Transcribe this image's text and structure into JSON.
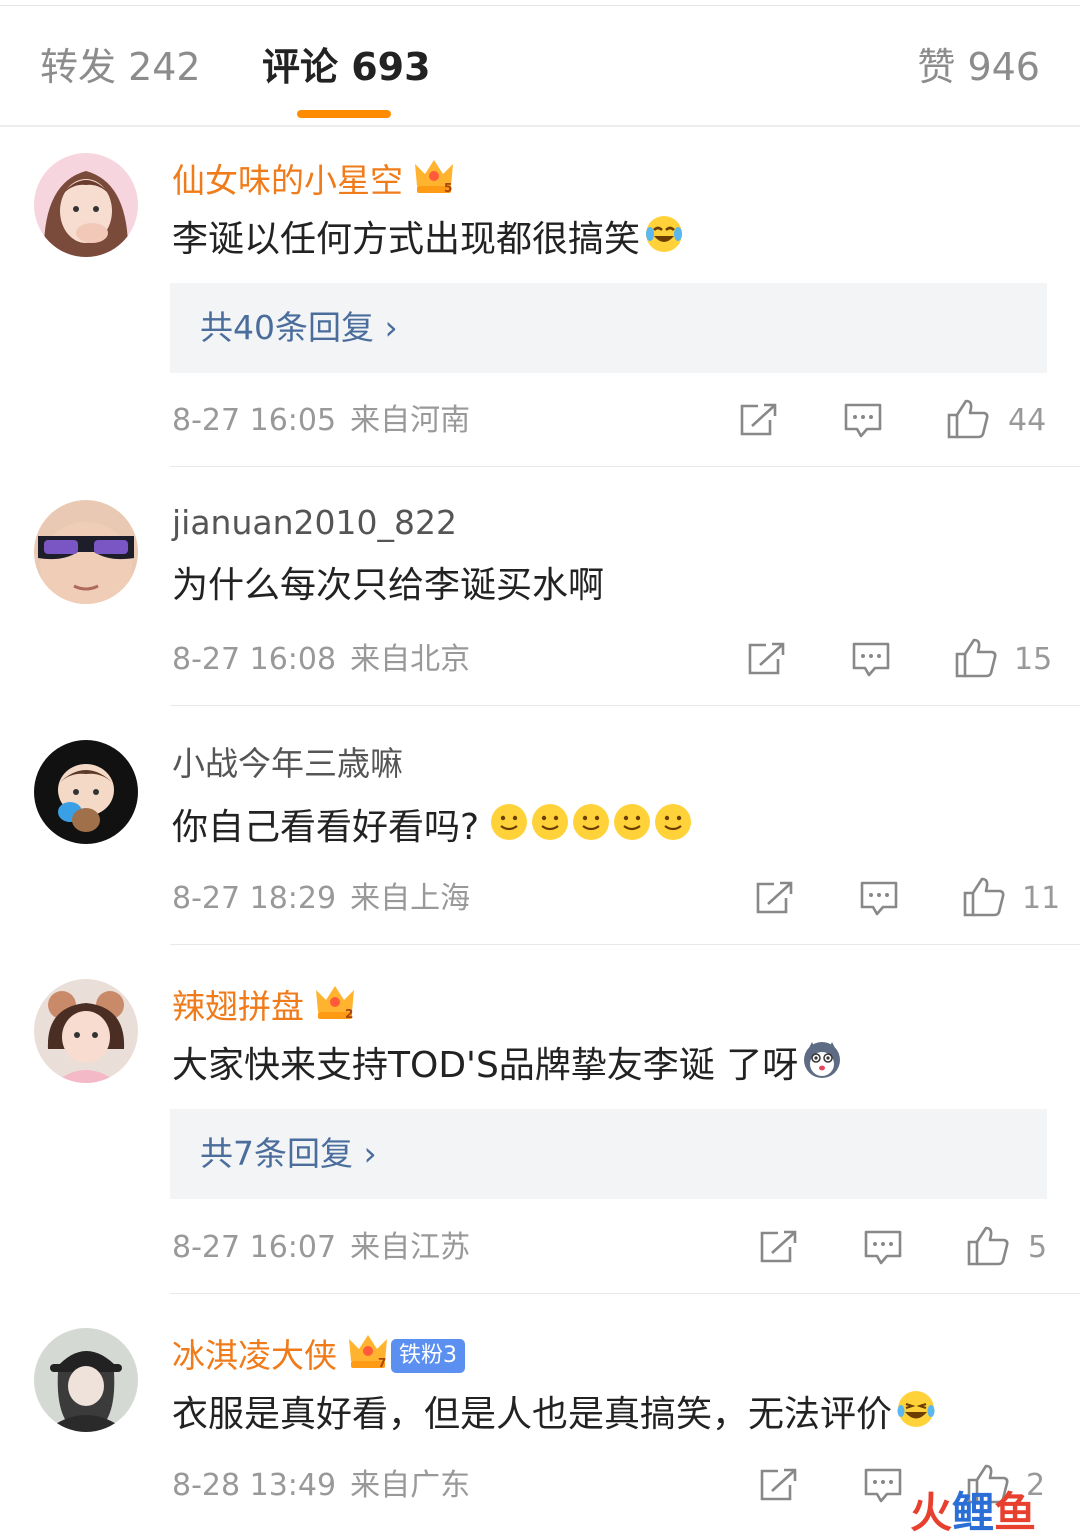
{
  "tabs": {
    "repost": "转发 242",
    "comments": "评论 693",
    "likes": "赞 946"
  },
  "colors": {
    "accent": "#ff8c00",
    "vip_name": "#f07b1a",
    "link": "#4a6d9c",
    "fan_badge": "#5b8ff0"
  },
  "comments": [
    {
      "username": "仙女味的小星空",
      "vip_level": "5",
      "text": "李诞以任何方式出现都很搞笑",
      "emoji": "laughing-crying-emoji",
      "replies": "共40条回复 ›",
      "time": "8-27 16:05",
      "location": "来自河南",
      "likes": "44"
    },
    {
      "username": "jianuan2010_822",
      "text": "为什么每次只给李诞买水啊",
      "time": "8-27 16:08",
      "location": "来自北京",
      "likes": "15"
    },
    {
      "username": "小战今年三歳嘛",
      "text": "你自己看看好看吗?",
      "emoji": "smile-emoji ×5",
      "time": "8-27 18:29",
      "location": "来自上海",
      "likes": "11"
    },
    {
      "username": "辣翅拼盘",
      "vip_level": "2",
      "text": "大家快来支持TOD'S品牌挚友李诞 了呀",
      "emoji": "husky-emoji",
      "replies": "共7条回复 ›",
      "time": "8-27 16:07",
      "location": "来自江苏",
      "likes": "5"
    },
    {
      "username": "冰淇凌大侠",
      "vip_level": "7",
      "fan_badge": "铁粉3",
      "text": "衣服是真好看，但是人也是真搞笑，无法评价",
      "emoji": "laughing-emoji",
      "time": "8-28 13:49",
      "location": "来自广东",
      "likes": "2"
    }
  ],
  "watermark": {
    "part1": "火",
    "part2": "鲤",
    "part3": "鱼"
  }
}
